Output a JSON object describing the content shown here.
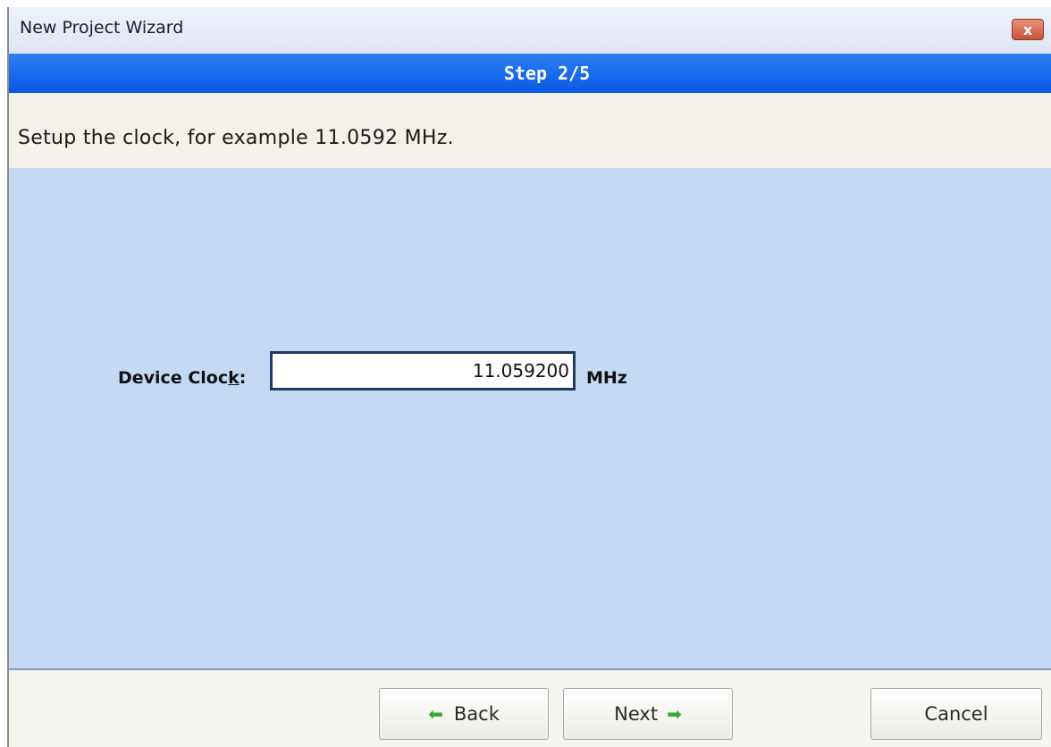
{
  "window": {
    "title": "New Project Wizard",
    "close_label": "x"
  },
  "step": {
    "label": "Step 2/5"
  },
  "instruction": {
    "text": "Setup the clock, for example 11.0592 MHz."
  },
  "clock": {
    "label_prefix": "Device Cloc",
    "label_underlined": "k",
    "label_suffix": ":",
    "value": "11.059200",
    "unit": "MHz"
  },
  "buttons": {
    "back_label": "Back",
    "next_label": "Next",
    "cancel_label": "Cancel",
    "arrow_left_icon": "green-left-arrow-icon",
    "arrow_right_icon": "green-right-arrow-icon"
  },
  "colors": {
    "step_bar": "#0958e6",
    "content_bg": "#c4daf4",
    "arrow": "#3aa73a",
    "close_button": "#c8533a"
  }
}
